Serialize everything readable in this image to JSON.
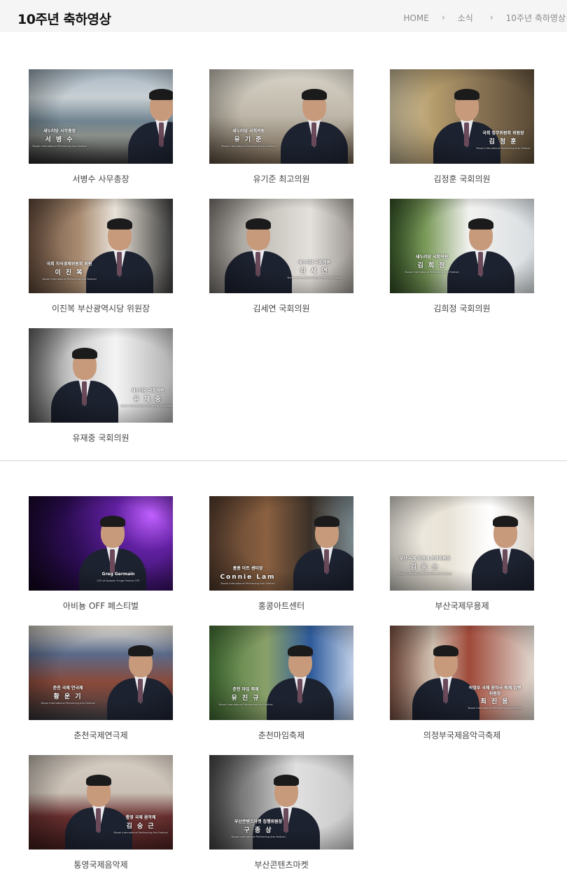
{
  "header": {
    "title": "10주년 축하영상",
    "breadcrumb": [
      "HOME",
      "소식",
      "10주년 축하영상"
    ]
  },
  "sections": [
    {
      "videos": [
        {
          "label": "서병수 사무총장",
          "caption_role": "새누리당 사무총장",
          "caption_name": "서 병 수",
          "scene": "sea",
          "accent": "#4a6a8a"
        },
        {
          "label": "유기준 최고의원",
          "caption_role": "새누리당 국회의원",
          "caption_name": "유 기 준",
          "scene": "office-plant",
          "accent": "#6a5a4a"
        },
        {
          "label": "김정훈 국회의원",
          "caption_role": "국회 정무위원회 위원장",
          "caption_name": "김 정 훈",
          "scene": "office-dark",
          "accent": "#5a4a3a"
        },
        {
          "label": "이진복 부산광역시당 위원장",
          "caption_role": "국회 지식경제위원회 위원",
          "caption_name": "이 진 복",
          "scene": "shelf",
          "accent": "#4a4a4a"
        },
        {
          "label": "김세연 국회의원",
          "caption_role": "새누리당 국회의원",
          "caption_name": "김 세 연",
          "scene": "window",
          "accent": "#5a5a5a"
        },
        {
          "label": "김희정 국회의원",
          "caption_role": "새누리당 국회의원",
          "caption_name": "김 희 정",
          "scene": "plant-bright",
          "accent": "#4a6a4a"
        },
        {
          "label": "유재중 국회의원",
          "caption_role": "새누리당 국회의원",
          "caption_name": "유 재 중",
          "scene": "office-bright",
          "accent": "#6a6a6a"
        }
      ]
    },
    {
      "videos": [
        {
          "label": "아비뇽 OFF 페스티벌",
          "caption_role": "Greg Germain",
          "caption_name": "",
          "caption_sub": "CEO of Avignon Fringe Festival OFF",
          "scene": "purple",
          "accent": "#3a1a6a"
        },
        {
          "label": "홍콩아트센터",
          "caption_role": "홍콩 아트 센터장",
          "caption_name": "Connie Lam",
          "scene": "art",
          "accent": "#4a3a2a"
        },
        {
          "label": "부산국제무용제",
          "caption_role": "부산 국제 무용제 운영위원장",
          "caption_name": "김 응 순",
          "scene": "poster",
          "accent": "#ddd"
        },
        {
          "label": "춘천국제연극제",
          "caption_role": "춘천 국제 연극제",
          "caption_name": "황 운 기",
          "scene": "books",
          "accent": "#3a4a6a"
        },
        {
          "label": "춘천마임축제",
          "caption_role": "춘천 마임 축제",
          "caption_name": "유 진 규",
          "scene": "mime",
          "accent": "#2a4a6a"
        },
        {
          "label": "의정부국제음악극축제",
          "caption_role": "의정부 국제 음악극 축제 집행위원장",
          "caption_name": "최 진 용",
          "scene": "books-2",
          "accent": "#6a4a3a"
        },
        {
          "label": "통영국제음악제",
          "caption_role": "통영 국제 음악제",
          "caption_name": "김 승 근",
          "scene": "sofa",
          "accent": "#6a3a3a"
        },
        {
          "label": "부산콘텐츠마켓",
          "caption_role": "부산콘텐츠마켓 집행위원장",
          "caption_name": "구 종 상",
          "scene": "office-grey",
          "accent": "#555"
        }
      ]
    }
  ],
  "caption_sub_default": "Busan International Performing Arts Festival"
}
